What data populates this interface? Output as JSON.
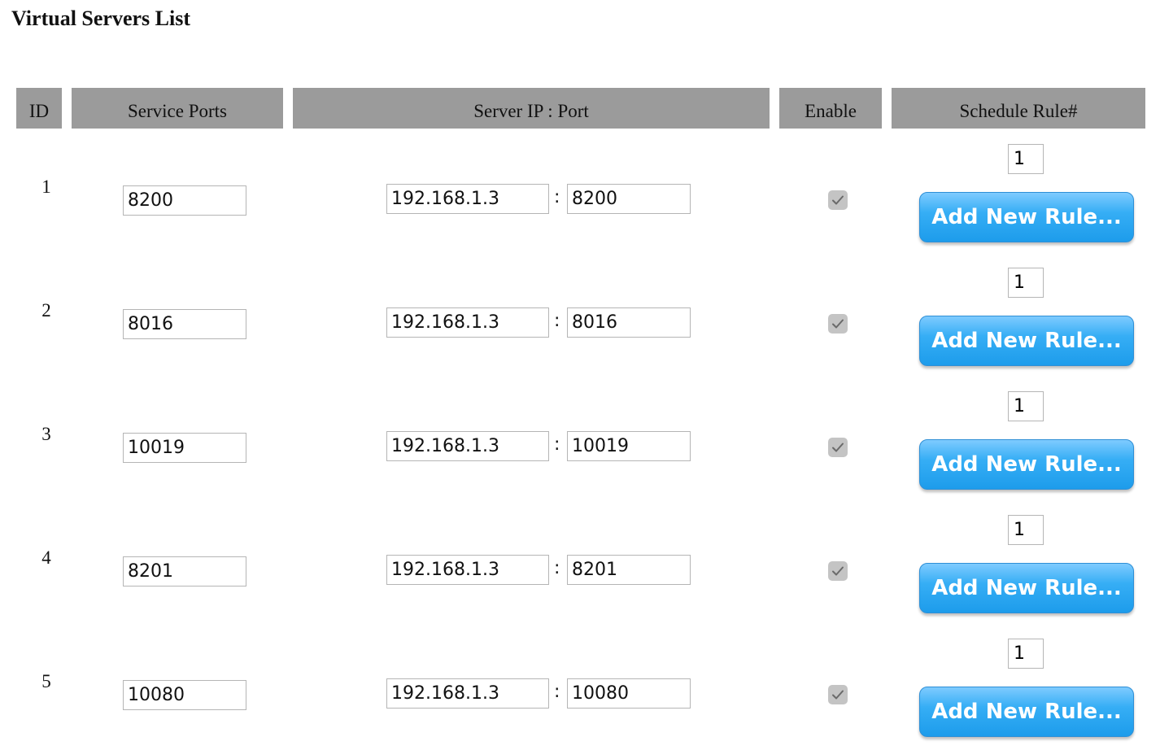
{
  "page": {
    "title": "Virtual Servers List"
  },
  "table": {
    "headers": {
      "id": "ID",
      "service_ports": "Service Ports",
      "server_ip_port": "Server IP : Port",
      "enable": "Enable",
      "schedule_rule": "Schedule Rule#"
    },
    "separator": ":",
    "add_rule_label": "Add New Rule...",
    "rows": [
      {
        "id": "1",
        "service_ports": "8200",
        "server_ip": "192.168.1.3",
        "server_port": "8200",
        "enabled": true,
        "schedule_rule": "1"
      },
      {
        "id": "2",
        "service_ports": "8016",
        "server_ip": "192.168.1.3",
        "server_port": "8016",
        "enabled": true,
        "schedule_rule": "1"
      },
      {
        "id": "3",
        "service_ports": "10019",
        "server_ip": "192.168.1.3",
        "server_port": "10019",
        "enabled": true,
        "schedule_rule": "1"
      },
      {
        "id": "4",
        "service_ports": "8201",
        "server_ip": "192.168.1.3",
        "server_port": "8201",
        "enabled": true,
        "schedule_rule": "1"
      },
      {
        "id": "5",
        "service_ports": "10080",
        "server_ip": "192.168.1.3",
        "server_port": "10080",
        "enabled": true,
        "schedule_rule": "1"
      }
    ]
  },
  "colors": {
    "header_bg": "#9b9b9b",
    "button_blue": "#36aef5",
    "checkbox_gray": "#c4c4c4"
  },
  "icons": {
    "enable_checkbox": "checkmark-icon"
  }
}
